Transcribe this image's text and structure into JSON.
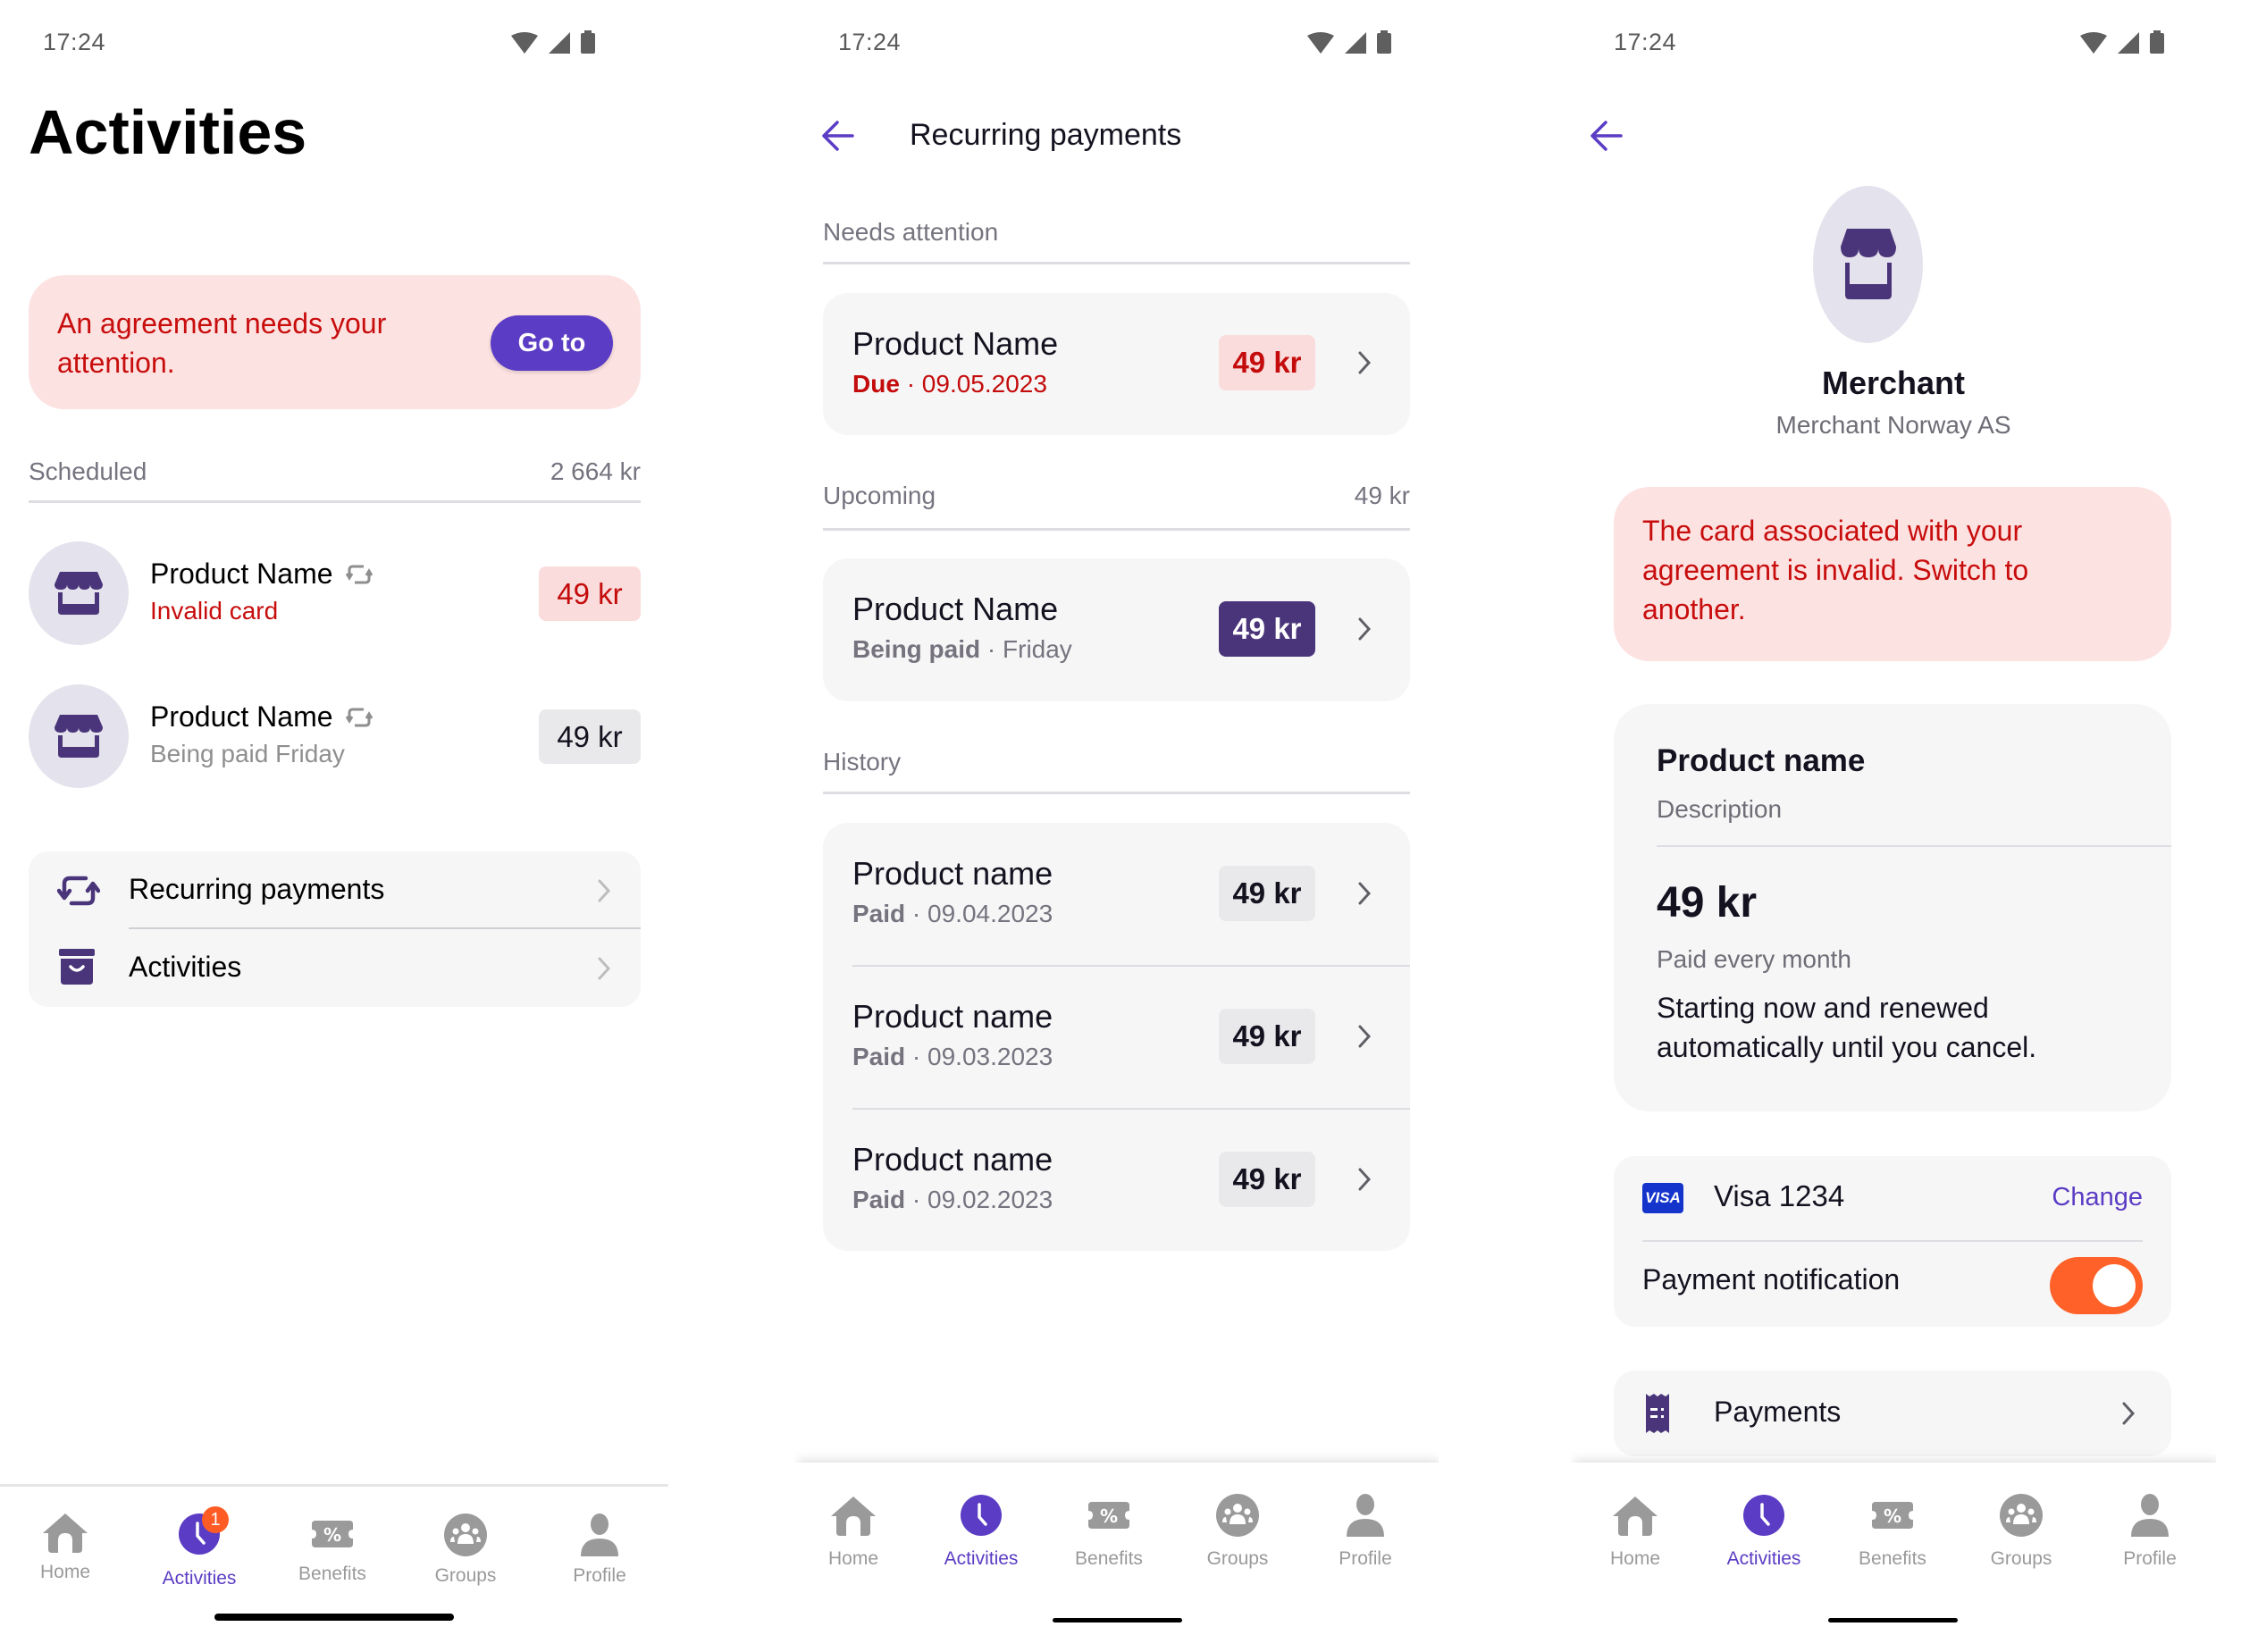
{
  "status_bar": {
    "time": "17:24"
  },
  "colors": {
    "brand_purple": "#5b3cc4",
    "dark_purple": "#4a357a",
    "error_red": "#c80d0d",
    "alert_bg": "#fde2e2",
    "toggle_orange": "#ff6128"
  },
  "screen_activities": {
    "title": "Activities",
    "alert": {
      "text": "An agreement needs your attention.",
      "button": "Go to"
    },
    "scheduled": {
      "label": "Scheduled",
      "total": "2 664 kr"
    },
    "items": [
      {
        "name": "Product Name",
        "status": "Invalid card",
        "status_type": "error",
        "amount": "49 kr",
        "recurring": true
      },
      {
        "name": "Product Name",
        "status": "Being paid Friday",
        "status_type": "normal",
        "amount": "49 kr",
        "recurring": true
      }
    ],
    "menu": [
      {
        "label": "Recurring payments",
        "icon": "recurring-icon"
      },
      {
        "label": "Activities",
        "icon": "archive-icon"
      }
    ]
  },
  "screen_recurring": {
    "title": "Recurring payments",
    "sections": {
      "needs_attention": {
        "label": "Needs attention",
        "items": [
          {
            "name": "Product Name",
            "status": "Due",
            "date": "09.05.2023",
            "amount": "49 kr"
          }
        ]
      },
      "upcoming": {
        "label": "Upcoming",
        "total": "49 kr",
        "items": [
          {
            "name": "Product Name",
            "status": "Being paid",
            "date": "Friday",
            "amount": "49 kr"
          }
        ]
      },
      "history": {
        "label": "History",
        "items": [
          {
            "name": "Product name",
            "status": "Paid",
            "date": "09.04.2023",
            "amount": "49 kr"
          },
          {
            "name": "Product name",
            "status": "Paid",
            "date": "09.03.2023",
            "amount": "49 kr"
          },
          {
            "name": "Product name",
            "status": "Paid",
            "date": "09.02.2023",
            "amount": "49 kr"
          }
        ]
      }
    }
  },
  "screen_agreement": {
    "merchant": {
      "name": "Merchant",
      "legal_name": "Merchant Norway AS"
    },
    "alert": {
      "text": "The card associated with your agreement is invalid. Switch to another."
    },
    "product": {
      "name": "Product name",
      "description": "Description",
      "price": "49 kr",
      "frequency": "Paid every month",
      "terms": "Starting now and renewed automatically until you cancel."
    },
    "payment_method": {
      "brand_badge": "VISA",
      "label": "Visa 1234",
      "change": "Change"
    },
    "notification": {
      "label": "Payment notification",
      "enabled": true
    },
    "payments_link": {
      "label": "Payments"
    }
  },
  "nav": {
    "items": [
      {
        "label": "Home",
        "icon": "home-icon"
      },
      {
        "label": "Activities",
        "icon": "clock-icon"
      },
      {
        "label": "Benefits",
        "icon": "ticket-percent-icon"
      },
      {
        "label": "Groups",
        "icon": "groups-icon"
      },
      {
        "label": "Profile",
        "icon": "person-icon"
      }
    ],
    "active_index": 1,
    "activities_badge": "1"
  }
}
